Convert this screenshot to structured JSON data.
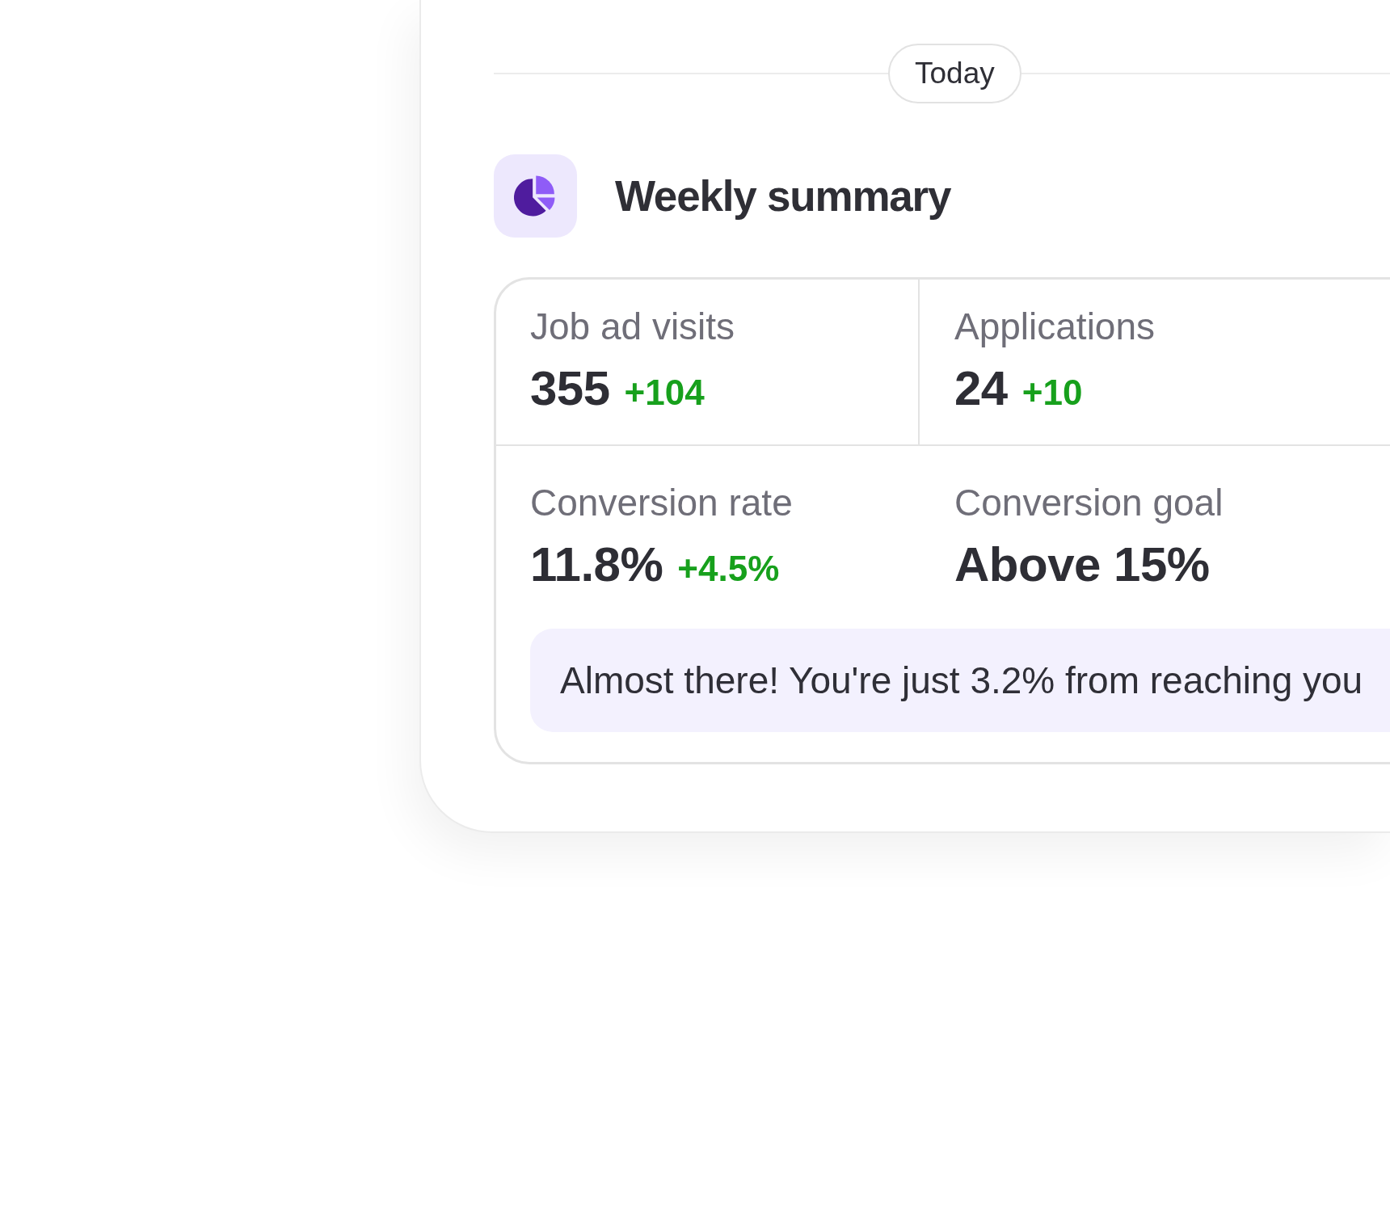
{
  "date_divider": {
    "label": "Today"
  },
  "summary": {
    "title": "Weekly summary",
    "metrics": [
      {
        "label": "Job ad visits",
        "value": "355",
        "change": "+104"
      },
      {
        "label": "Applications",
        "value": "24",
        "change": "+10"
      },
      {
        "label": "Conversion rate",
        "value": "11.8%",
        "change": "+4.5%"
      },
      {
        "label": "Conversion goal",
        "value": "Above 15%"
      }
    ],
    "message": "Almost there! You're just 3.2% from reaching you"
  }
}
